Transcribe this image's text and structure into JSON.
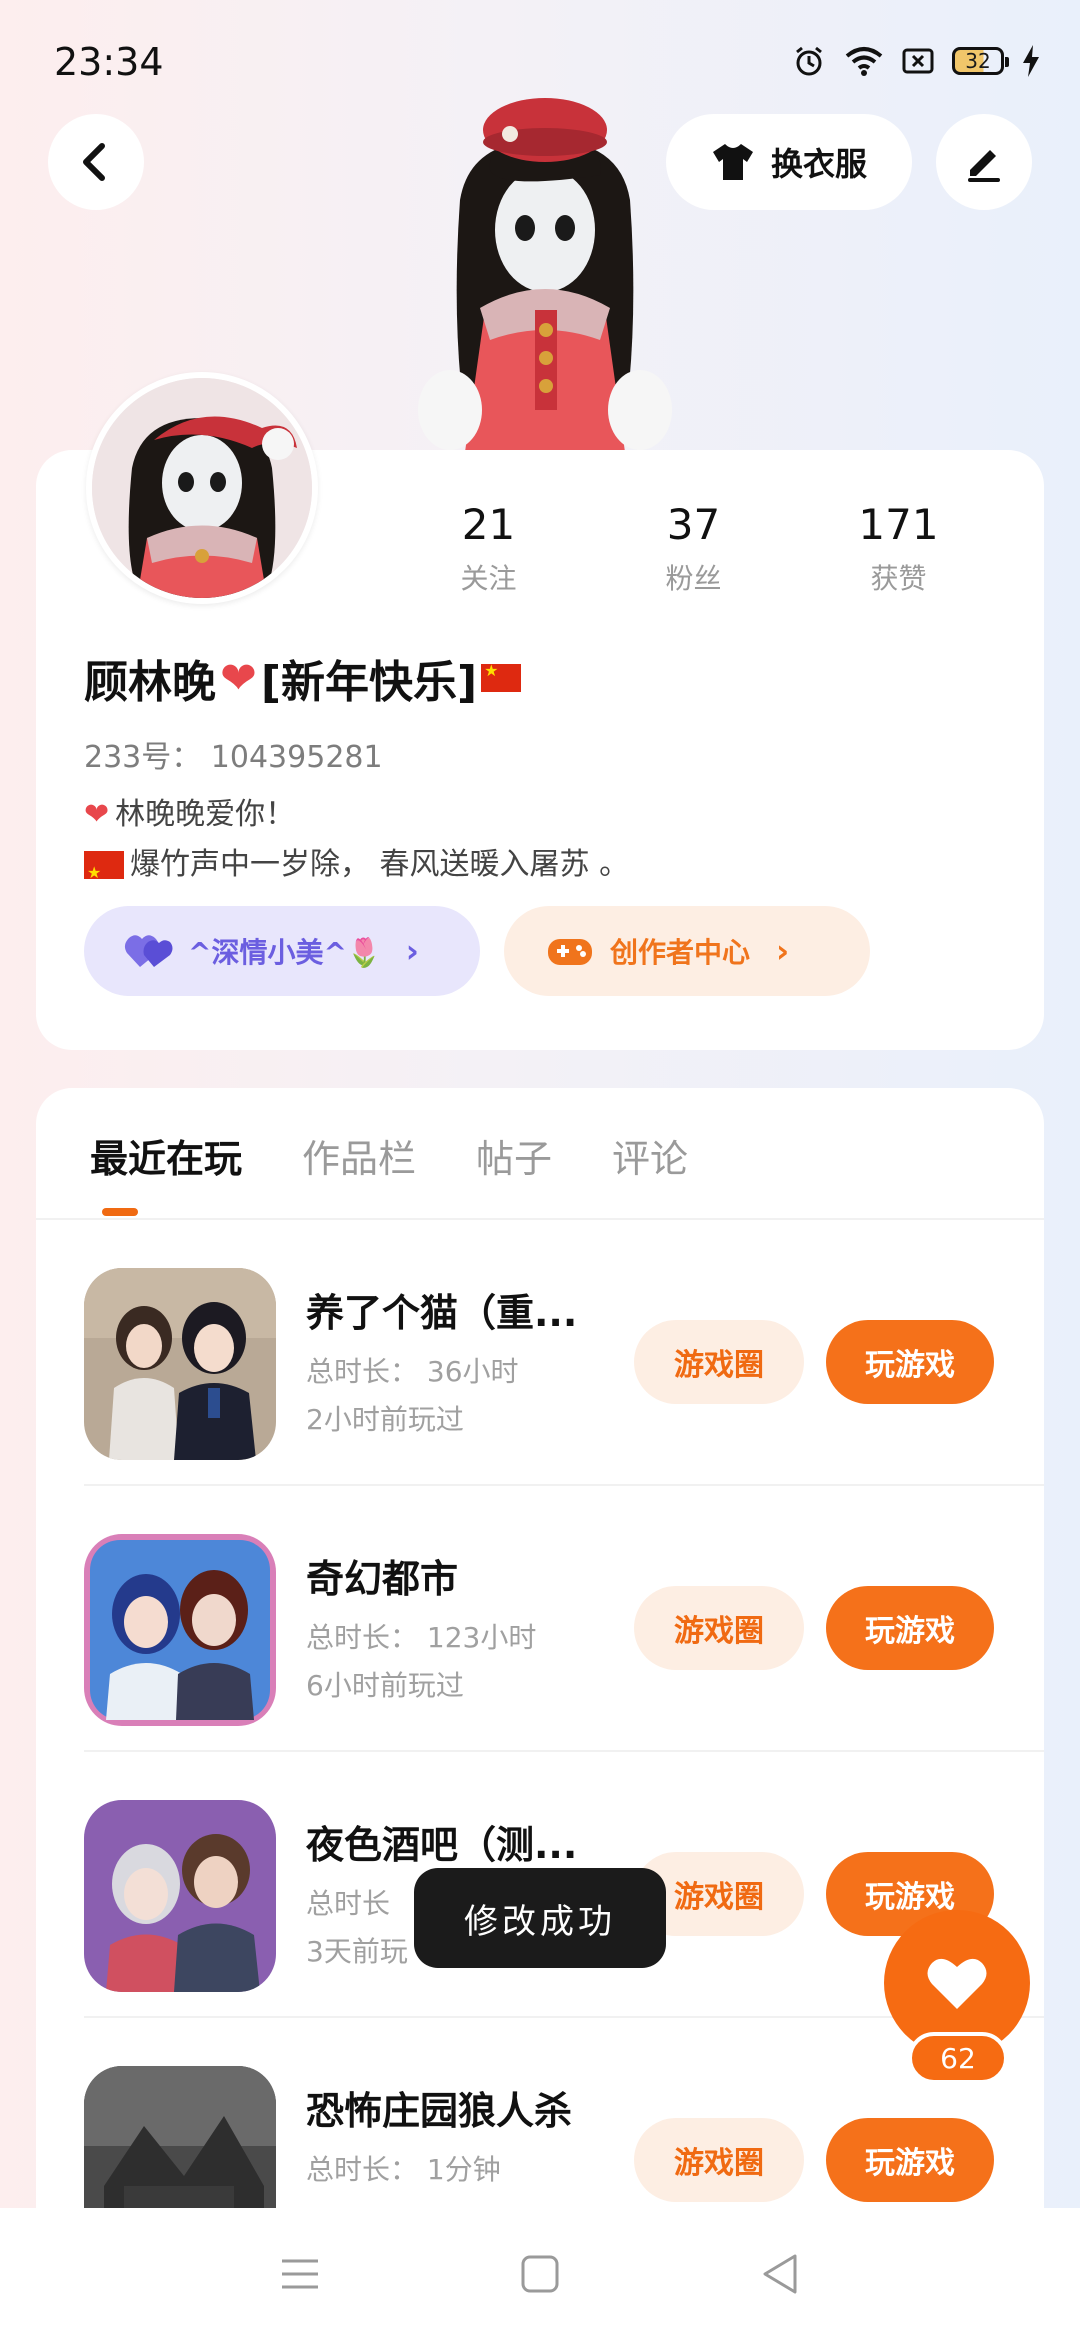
{
  "status_bar": {
    "time": "23:34",
    "battery": "32"
  },
  "header": {
    "dress_label": "换衣服"
  },
  "profile": {
    "stats": [
      {
        "num": "21",
        "label": "关注"
      },
      {
        "num": "37",
        "label": "粉丝"
      },
      {
        "num": "171",
        "label": "获赞"
      }
    ],
    "nickname_prefix": "顾林晚",
    "nickname_suffix": "[新年快乐]",
    "uid": "233号： 104395281",
    "bio_line1": "林晚晚爱你！",
    "bio_line2": "爆竹声中一岁除， 春风送暖入屠苏 。",
    "pill_left_label": "^深情小美^🌷",
    "pill_right_label": "创作者中心"
  },
  "tabs": [
    "最近在玩",
    "作品栏",
    "帖子",
    "评论"
  ],
  "games": [
    {
      "title": "养了个猫（重...",
      "duration": "总时长： 36小时",
      "last": "2小时前玩过",
      "circle": "游戏圈",
      "play": "玩游戏"
    },
    {
      "title": "奇幻都市",
      "duration": "总时长： 123小时",
      "last": "6小时前玩过",
      "circle": "游戏圈",
      "play": "玩游戏"
    },
    {
      "title": "夜色酒吧（测...",
      "duration": "总时长",
      "last": "3天前玩",
      "circle": "游戏圈",
      "play": "玩游戏"
    },
    {
      "title": "恐怖庄园狼人杀",
      "duration": "总时长： 1分钟",
      "last": "",
      "circle": "游戏圈",
      "play": "玩游戏"
    }
  ],
  "toast": "修改成功",
  "like_count": "62",
  "colors": {
    "accent": "#f5711a",
    "accent_soft": "#fdeee3",
    "purple": "#6b5ee0",
    "purple_soft": "#e8e6fc"
  },
  "icons": [
    "back-icon",
    "shirt-icon",
    "pen-icon",
    "purple-heart-icon",
    "gamepad-icon",
    "heart-icon",
    "menu-icon",
    "home-icon",
    "back-triangle-icon"
  ]
}
